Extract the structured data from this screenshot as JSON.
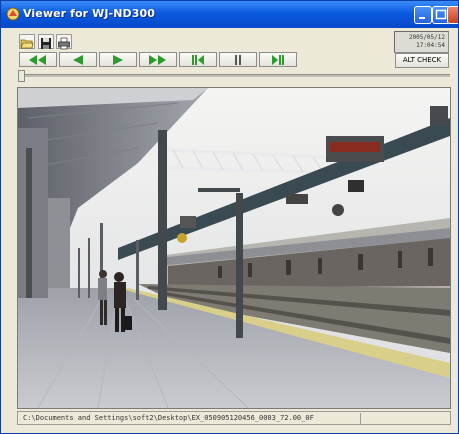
{
  "window": {
    "title": "Viewer for WJ-ND300",
    "title_icon": "viewer-app-icon",
    "buttons": [
      "minimize-icon",
      "maximize-icon",
      "close-icon"
    ]
  },
  "toolbar": {
    "icons": [
      "open-folder-icon",
      "save-disk-icon",
      "print-icon"
    ],
    "datetime_line1": "2005/05/12",
    "datetime_line2": "17:04:54"
  },
  "playback": {
    "buttons": [
      "fast-rewind-icon",
      "reverse-play-icon",
      "play-icon",
      "fast-forward-icon",
      "step-back-icon",
      "pause-icon",
      "step-forward-icon"
    ],
    "alt_check_label": "ALT CHECK",
    "slider_position_fraction": 0.0,
    "accent_color": "#2d9a2d"
  },
  "status_bar": {
    "path": "C:\\Documents and Settings\\soft2\\Desktop\\EX_050905120456_0003_72.00_0F"
  },
  "colors": {
    "titlebar": "#0a5ae0",
    "window_bg": "#ece9d8"
  }
}
